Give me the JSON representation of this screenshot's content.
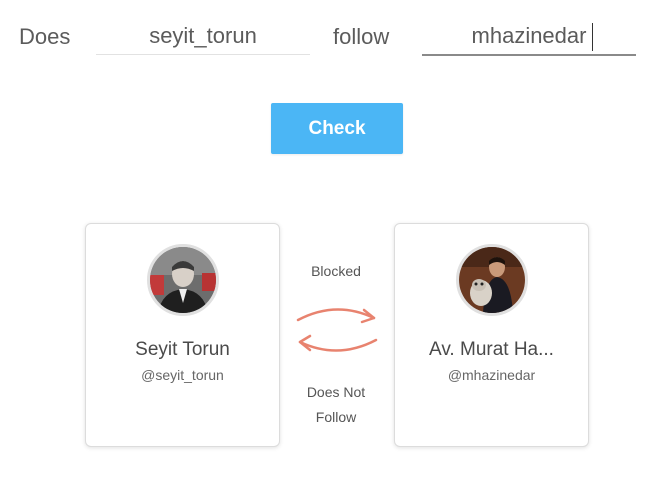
{
  "query": {
    "word_does": "Does",
    "first_username": "seyit_torun",
    "word_follow": "follow",
    "second_username": "mhazinedar"
  },
  "check_button_label": "Check",
  "left_user": {
    "display_name": "Seyit Torun",
    "handle": "@seyit_torun"
  },
  "right_user": {
    "display_name": "Av. Murat Ha...",
    "handle": "@mhazinedar"
  },
  "relation": {
    "top_status": "Blocked",
    "bottom_status_line1": "Does Not",
    "bottom_status_line2": "Follow"
  },
  "colors": {
    "button": "#4bb6f5",
    "arrows": "#e8836f"
  }
}
